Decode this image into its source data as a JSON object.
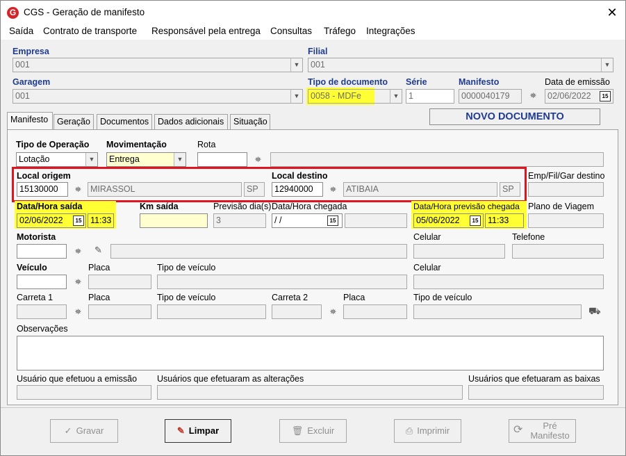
{
  "window": {
    "title": "CGS - Geração de manifesto",
    "close": "✕",
    "logo": "G"
  },
  "menu": [
    "Saída",
    "Contrato de transporte",
    "Responsável pela entrega",
    "Consultas",
    "Tráfego",
    "Integrações"
  ],
  "header": {
    "empresa_label": "Empresa",
    "empresa_value": "001",
    "filial_label": "Filial",
    "filial_value": "001",
    "garagem_label": "Garagem",
    "garagem_value": "001",
    "tipo_doc_label": "Tipo de documento",
    "tipo_doc_value": "0058 - MDFe",
    "serie_label": "Série",
    "serie_value": "1",
    "manifesto_label": "Manifesto",
    "manifesto_value": "0000040179",
    "data_emissao_label": "Data de emissão",
    "data_emissao_value": "02/06/2022",
    "status": "NOVO DOCUMENTO"
  },
  "tabs": [
    "Manifesto",
    "Geração",
    "Documentos",
    "Dados adicionais",
    "Situação"
  ],
  "form": {
    "tipo_operacao_label": "Tipo de Operação",
    "tipo_operacao_value": "Lotação",
    "movimentacao_label": "Movimentação",
    "movimentacao_value": "Entrega",
    "rota_label": "Rota",
    "local_origem_label": "Local origem",
    "origem_code": "15130000",
    "origem_city": "MIRASSOL",
    "origem_uf": "SP",
    "local_destino_label": "Local destino",
    "destino_code": "12940000",
    "destino_city": "ATIBAIA",
    "destino_uf": "SP",
    "emp_fil_gar_label": "Emp/Fil/Gar destino",
    "data_saida_label": "Data/Hora saída",
    "data_saida_date": "02/06/2022",
    "data_saida_time": "11:33",
    "km_saida_label": "Km saída",
    "previsao_dias_label": "Previsão dia(s)",
    "previsao_dias_value": "3",
    "data_chegada_label": "Data/Hora chegada",
    "data_chegada_value": " /  /",
    "data_prev_chegada_label": "Data/Hora previsão chegada",
    "data_prev_date": "05/06/2022",
    "data_prev_time": "11:33",
    "plano_viagem_label": "Plano de Viagem",
    "motorista_label": "Motorista",
    "celular_label": "Celular",
    "telefone_label": "Telefone",
    "veiculo_label": "Veículo",
    "placa_label": "Placa",
    "tipo_veiculo_label": "Tipo de veículo",
    "celular2_label": "Celular",
    "carreta1_label": "Carreta 1",
    "placa2_label": "Placa",
    "tipo_veiculo2_label": "Tipo de veículo",
    "carreta2_label": "Carreta 2",
    "placa3_label": "Placa",
    "tipo_veiculo3_label": "Tipo de veículo",
    "observacoes_label": "Observações",
    "usuario_emissao_label": "Usuário que efetuou a emissão",
    "usuarios_alteracoes_label": "Usuários que efetuaram as alterações",
    "usuarios_baixas_label": "Usuários que efetuaram as baixas"
  },
  "buttons": {
    "gravar": "Gravar",
    "limpar": "Limpar",
    "excluir": "Excluir",
    "imprimir": "Imprimir",
    "pre_manifesto_1": "Pré",
    "pre_manifesto_2": "Manifesto"
  },
  "icons": {
    "calendar": "15",
    "binoculars": "⛯",
    "dropdown": "▼"
  },
  "colors": {
    "highlight": "#ffff33",
    "redbox": "#e3121f",
    "label_blue": "#1f3b8f"
  }
}
